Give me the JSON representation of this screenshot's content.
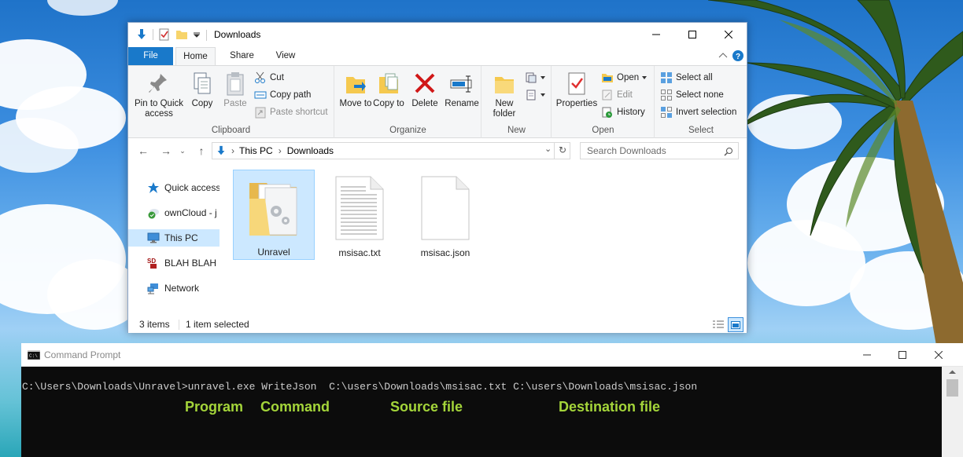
{
  "explorer": {
    "title": "Downloads",
    "tabs": {
      "file": "File",
      "home": "Home",
      "share": "Share",
      "view": "View"
    },
    "clipboard": {
      "label": "Clipboard",
      "pin": "Pin to Quick access",
      "copy": "Copy",
      "paste": "Paste",
      "cut": "Cut",
      "copy_path": "Copy path",
      "paste_shortcut": "Paste shortcut"
    },
    "organize": {
      "label": "Organize",
      "move_to": "Move to",
      "copy_to": "Copy to",
      "delete": "Delete",
      "rename": "Rename"
    },
    "new_group": {
      "label": "New",
      "new_folder": "New folder"
    },
    "open_group": {
      "label": "Open",
      "properties": "Properties",
      "open": "Open",
      "edit": "Edit",
      "history": "History"
    },
    "select_group": {
      "label": "Select",
      "select_all": "Select all",
      "select_none": "Select none",
      "invert": "Invert selection"
    },
    "address": {
      "root": "This PC",
      "current": "Downloads"
    },
    "search": {
      "placeholder": "Search Downloads"
    },
    "nav": [
      {
        "label": "Quick access"
      },
      {
        "label": "ownCloud - j"
      },
      {
        "label": "This PC"
      },
      {
        "label": "BLAH BLAH ("
      },
      {
        "label": "Network"
      }
    ],
    "files": [
      {
        "name": "Unravel"
      },
      {
        "name": "msisac.txt"
      },
      {
        "name": "msisac.json"
      }
    ],
    "status": {
      "count": "3 items",
      "selected": "1 item selected"
    }
  },
  "cmd": {
    "title": "Command Prompt",
    "line": "C:\\Users\\Downloads\\Unravel>unravel.exe WriteJson  C:\\users\\Downloads\\msisac.txt C:\\users\\Downloads\\msisac.json",
    "annotations": {
      "program": "Program",
      "command": "Command",
      "source": "Source file",
      "destination": "Destination file"
    },
    "annotation_color": "#a4d53a"
  },
  "colors": {
    "file_tab": "#1979ca",
    "selection": "#cce8ff"
  }
}
